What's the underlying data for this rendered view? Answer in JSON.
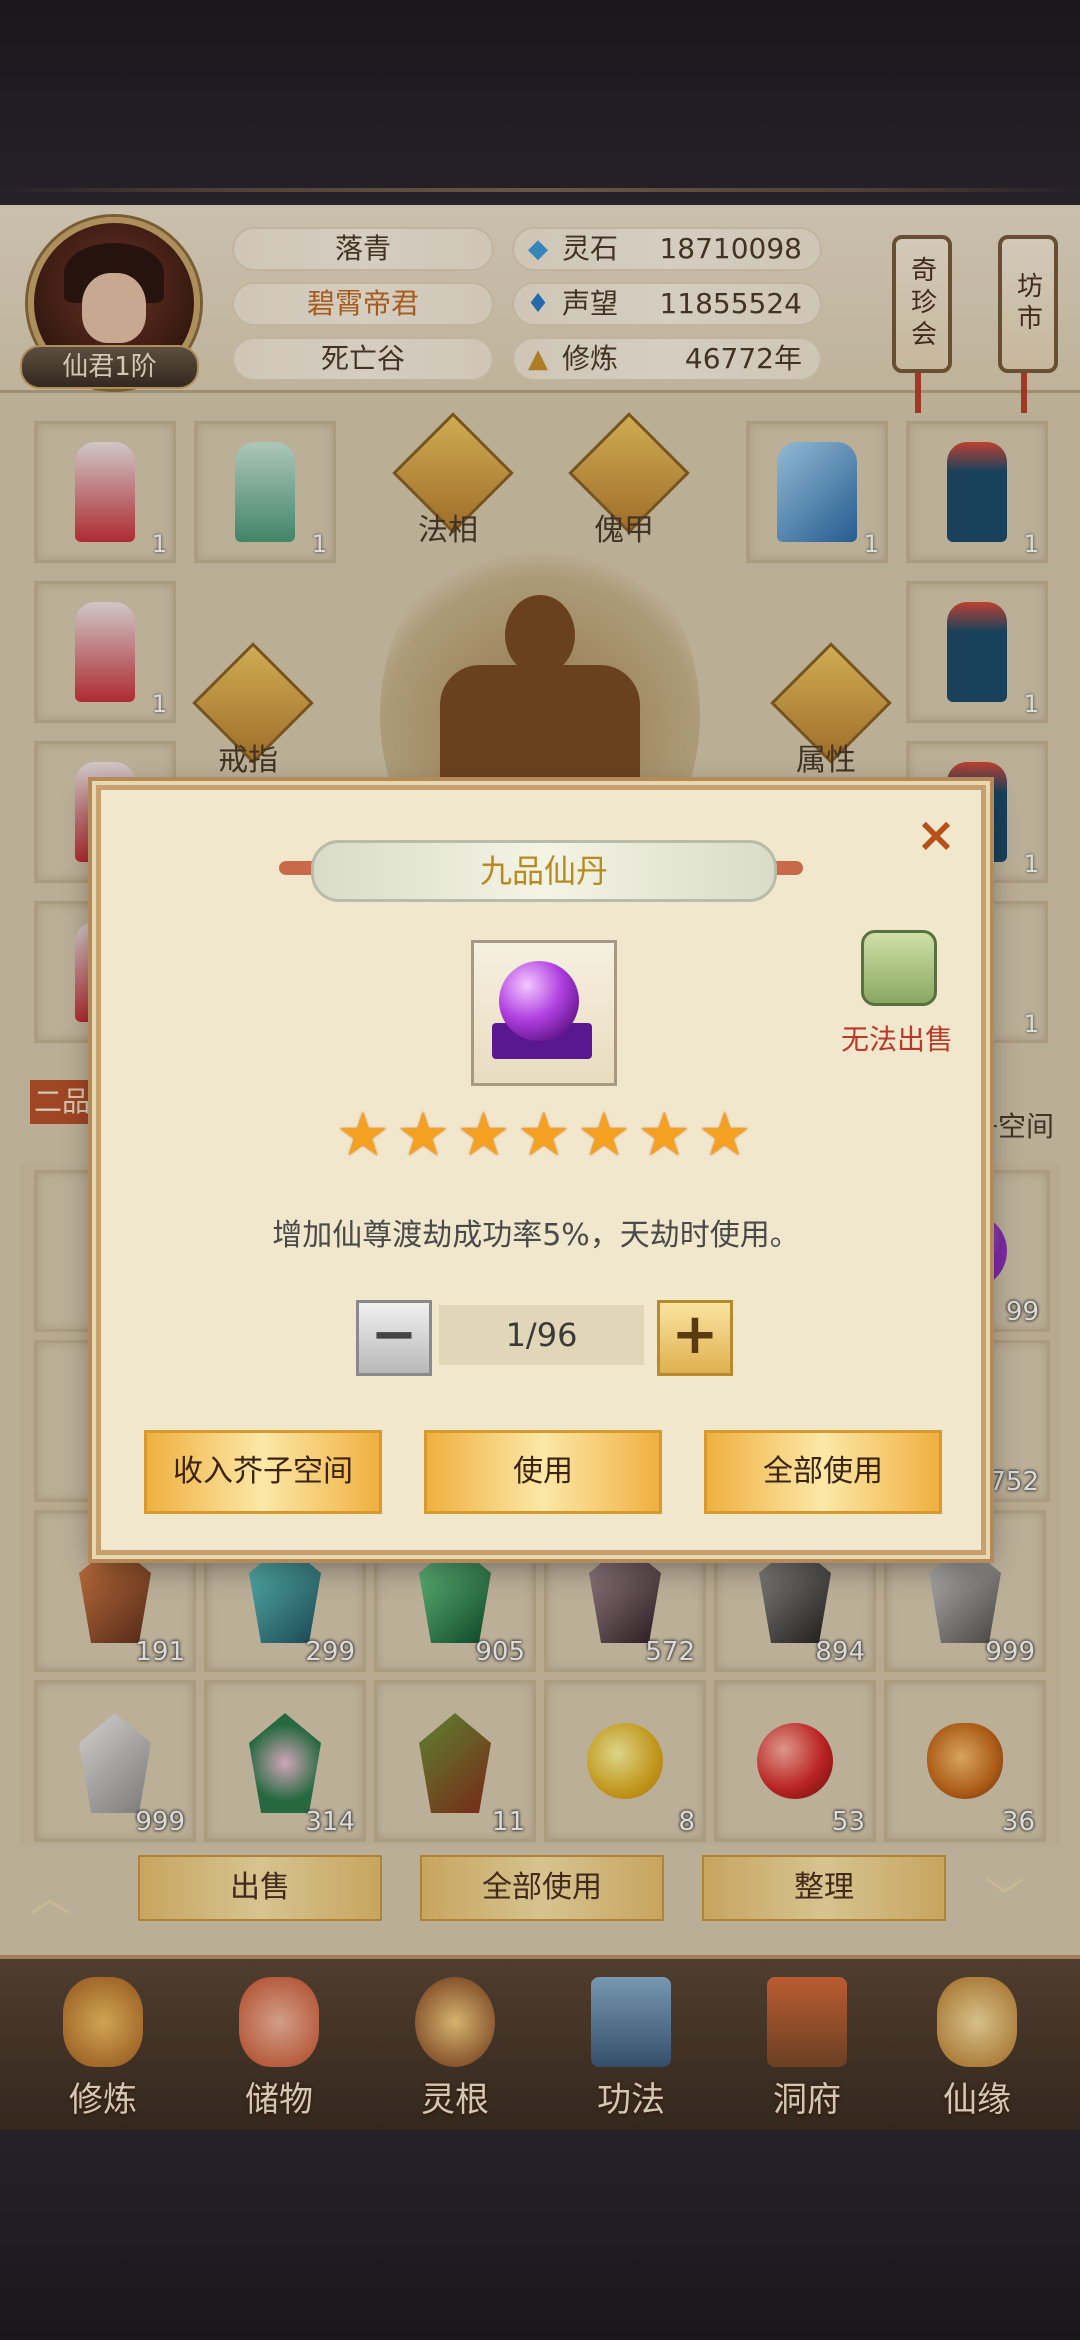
{
  "player": {
    "name": "落青",
    "title": "碧霄帝君",
    "location": "死亡谷",
    "rank": "仙君1阶"
  },
  "resources": [
    {
      "icon": "blue-crystal-icon",
      "label": "灵石",
      "value": "18710098"
    },
    {
      "icon": "blue-flame-icon",
      "label": "声望",
      "value": "11855524"
    },
    {
      "icon": "meditation-icon",
      "label": "修炼",
      "value": "46772年"
    }
  ],
  "shops": {
    "treasure": "奇珍会",
    "market": "坊市"
  },
  "equipment": {
    "slots_left": [
      {
        "count": "1"
      },
      {
        "count": "1"
      },
      {
        "count": "1"
      }
    ],
    "slot_left_top2": {
      "count": "1"
    },
    "slots_right": [
      {
        "count": "1"
      },
      {
        "count": "1"
      },
      {
        "count": "1"
      },
      {
        "count": "1"
      },
      {
        "count": "1"
      }
    ],
    "tabs": {
      "faxiang": "法相",
      "kuijia": "傀甲",
      "jiezhi": "戒指",
      "shuxing": "属性"
    }
  },
  "inventory": {
    "side_label_left": "二品",
    "side_label_right": "子空间",
    "partial_counts": {
      "right_row1": "99",
      "right_row2": "752"
    },
    "row3": [
      {
        "icon": "rust-crystal-icon",
        "count": "191"
      },
      {
        "icon": "teal-crystal-icon",
        "count": "299"
      },
      {
        "icon": "green-crystal-icon",
        "count": "905"
      },
      {
        "icon": "dark-crystal-icon",
        "count": "572"
      },
      {
        "icon": "black-ore-icon",
        "count": "894"
      },
      {
        "icon": "grey-ore-icon",
        "count": "999"
      }
    ],
    "row4": [
      {
        "icon": "white-stone-icon",
        "count": "999"
      },
      {
        "icon": "herb-plant-icon",
        "count": "314"
      },
      {
        "icon": "red-branch-icon",
        "count": "11"
      },
      {
        "icon": "yellow-orb-icon",
        "count": "8"
      },
      {
        "icon": "red-orb-icon",
        "count": "53"
      },
      {
        "icon": "gourd-icon",
        "count": "36"
      }
    ]
  },
  "actions": {
    "sell": "出售",
    "use_all": "全部使用",
    "sort": "整理"
  },
  "nav": [
    {
      "icon": "cultivate-icon",
      "label": "修炼"
    },
    {
      "icon": "storage-bag-icon",
      "label": "储物"
    },
    {
      "icon": "spirit-root-icon",
      "label": "灵根"
    },
    {
      "icon": "technique-book-icon",
      "label": "功法"
    },
    {
      "icon": "cave-house-icon",
      "label": "洞府"
    },
    {
      "icon": "fortune-gourd-icon",
      "label": "仙缘"
    }
  ],
  "modal": {
    "title": "九品仙丹",
    "item_icon": "purple-pill-icon",
    "sell_status": "无法出售",
    "stars": 7,
    "star_glyphs": [
      "★",
      "★",
      "★",
      "★",
      "★",
      "★",
      "★"
    ],
    "description": "增加仙尊渡劫成功率5%，天劫时使用。",
    "quantity": "1/96",
    "minus": "−",
    "plus": "+",
    "close": "×",
    "buttons": {
      "store": "收入芥子空间",
      "use": "使用",
      "use_all": "全部使用"
    }
  },
  "colors": {
    "accent_gold": "#f0b040",
    "title_gold": "#b88a20",
    "warning_red": "#b83a2a"
  }
}
